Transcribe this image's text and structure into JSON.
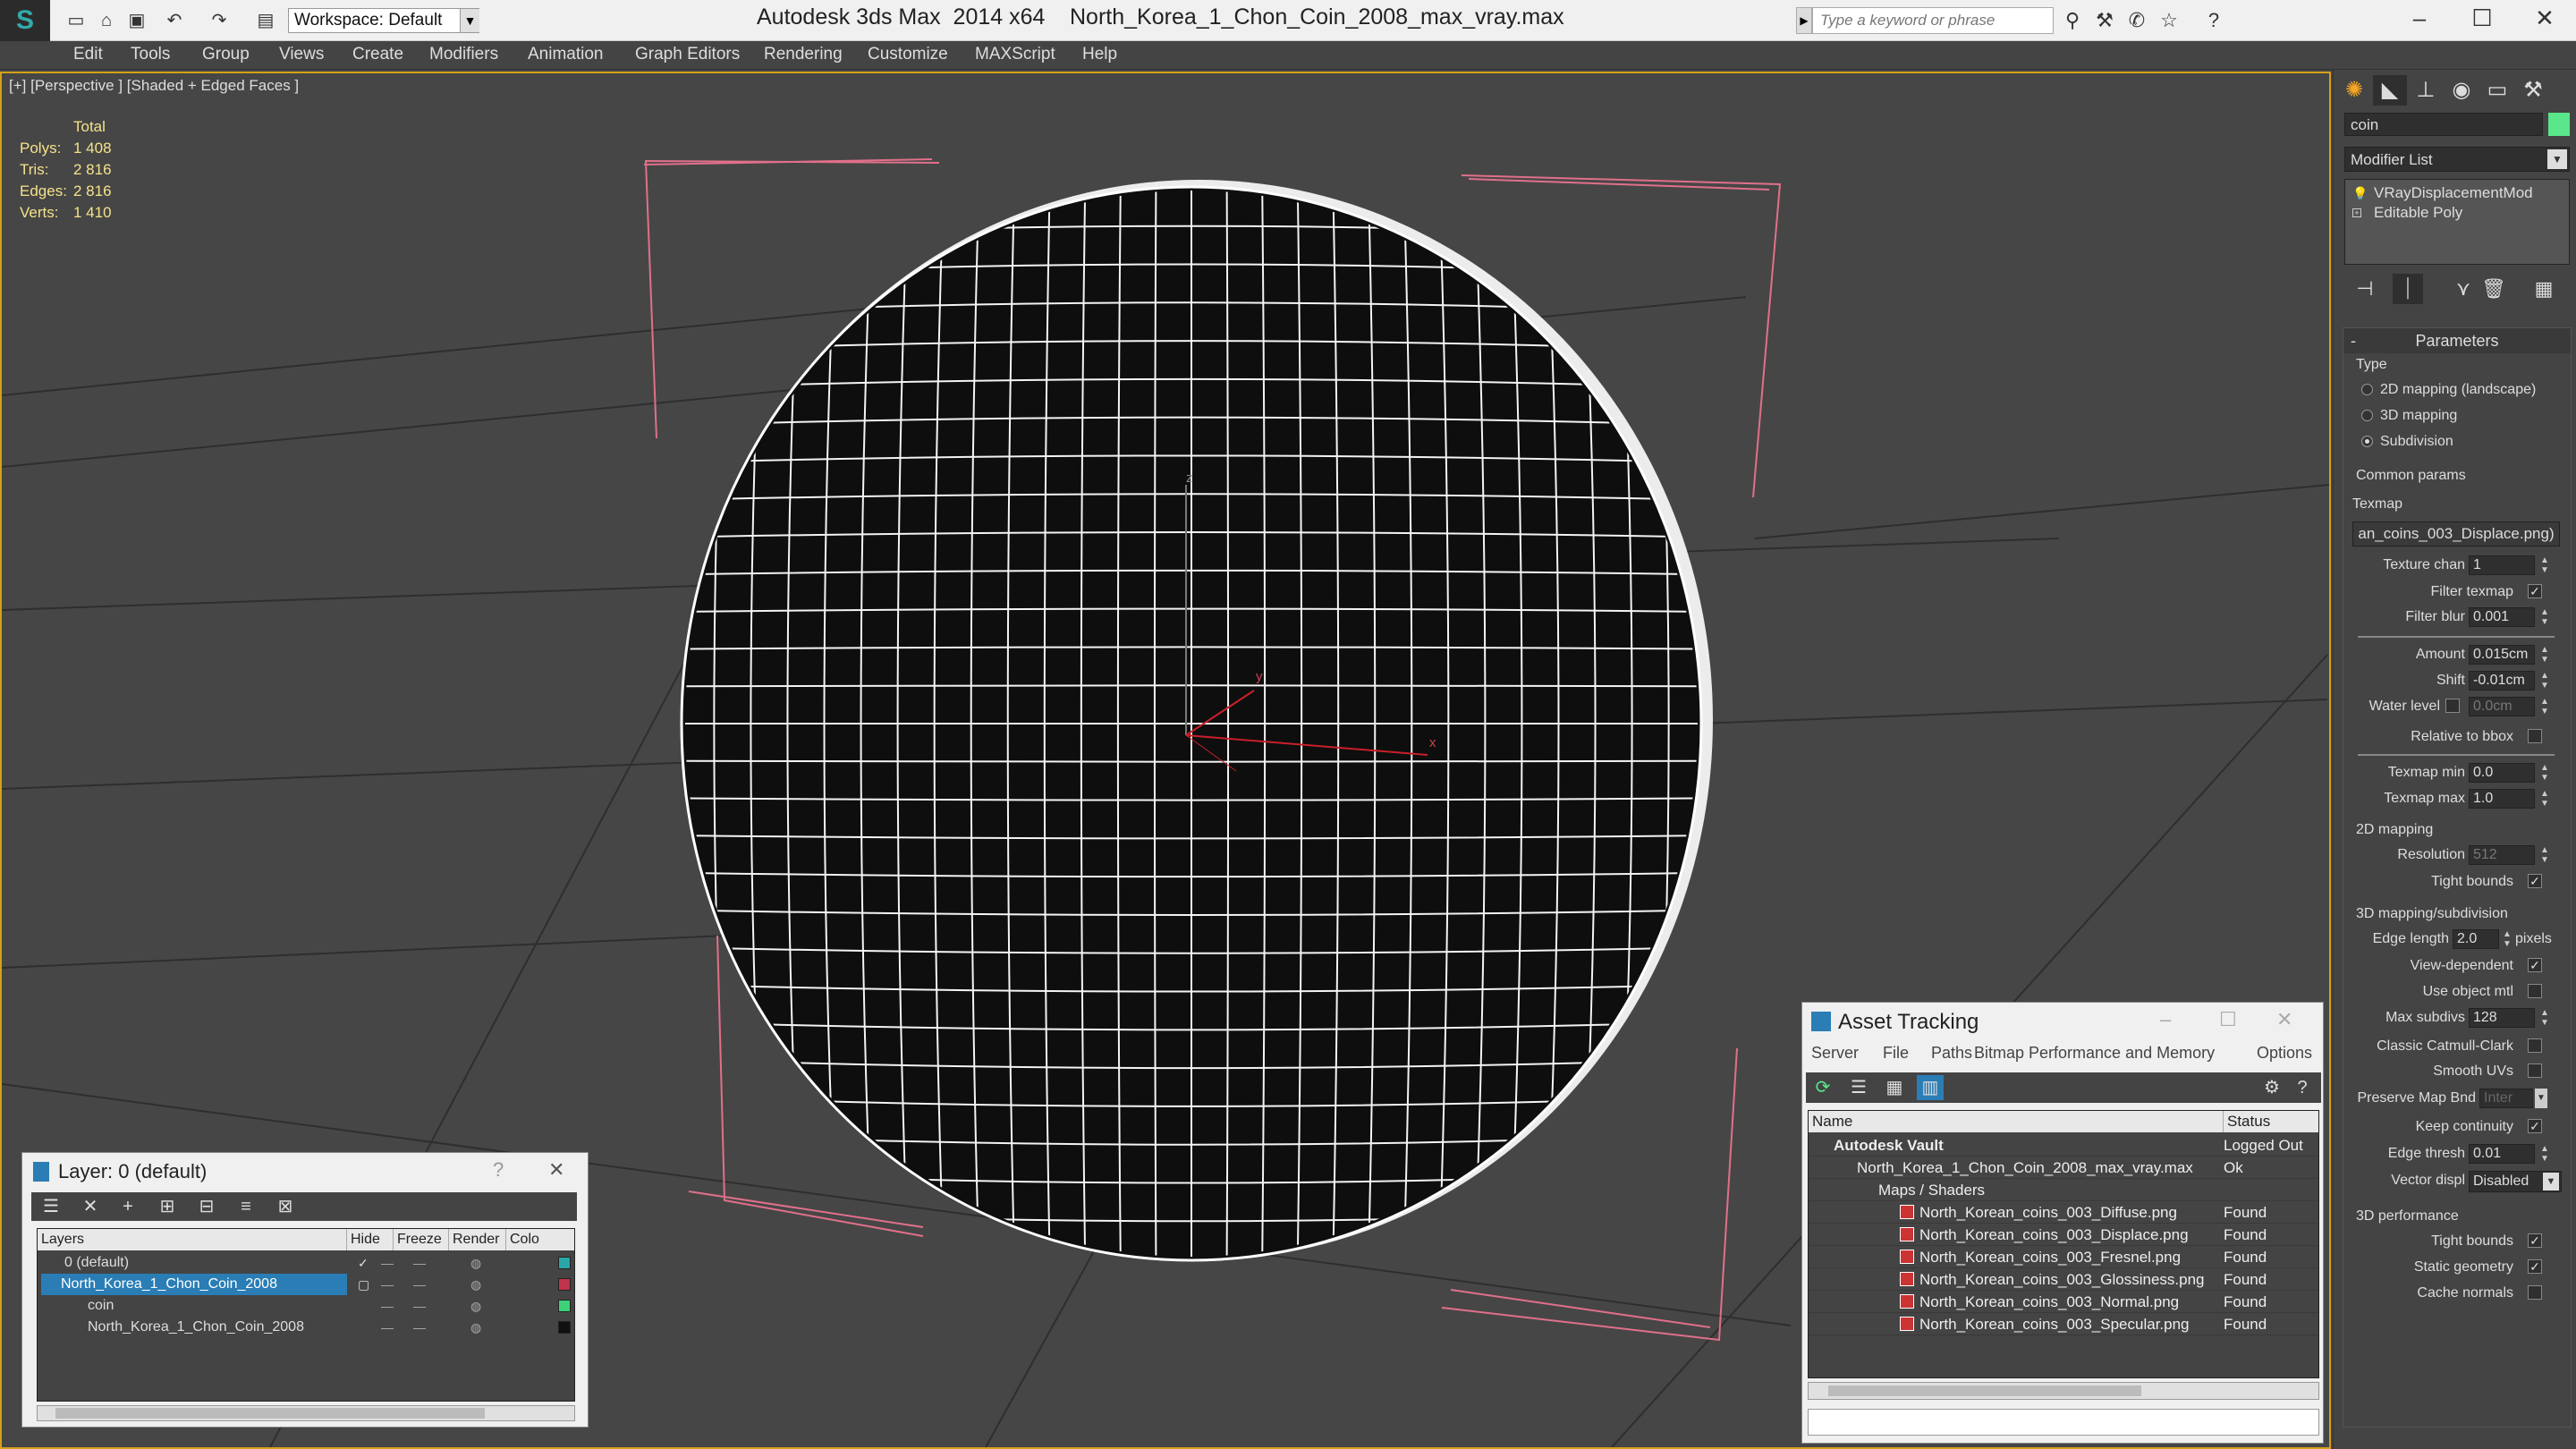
{
  "titlebar": {
    "app_title": "Autodesk 3ds Max  2014 x64",
    "file_title": "North_Korea_1_Chon_Coin_2008_max_vray.max",
    "workspace": "Workspace: Default",
    "search_placeholder": "Type a keyword or phrase"
  },
  "menu": [
    "Edit",
    "Tools",
    "Group",
    "Views",
    "Create",
    "Modifiers",
    "Animation",
    "Graph Editors",
    "Rendering",
    "Customize",
    "MAXScript",
    "Help"
  ],
  "viewport": {
    "label": "[+] [Perspective ] [Shaded + Edged Faces ]",
    "stats_header": "Total",
    "stats": [
      {
        "label": "Polys:",
        "value": "1 408"
      },
      {
        "label": "Tris:",
        "value": "2 816"
      },
      {
        "label": "Edges:",
        "value": "2 816"
      },
      {
        "label": "Verts:",
        "value": "1 410"
      }
    ],
    "axis_x": "x",
    "axis_y": "y",
    "axis_z": "z"
  },
  "command_panel": {
    "object_name": "coin",
    "modifier_list": "Modifier List",
    "stack": [
      "VRayDisplacementMod",
      "Editable Poly"
    ],
    "rollout_title": "Parameters",
    "type_group": "Type",
    "type_options": [
      "2D mapping (landscape)",
      "3D mapping",
      "Subdivision"
    ],
    "common_group": "Common params",
    "texmap_label": "Texmap",
    "texmap_value": "an_coins_003_Displace.png)",
    "texture_chan_label": "Texture chan",
    "texture_chan": "1",
    "filter_texmap": "Filter texmap",
    "filter_blur_label": "Filter blur",
    "filter_blur": "0.001",
    "amount_label": "Amount",
    "amount": "0.015cm",
    "shift_label": "Shift",
    "shift": "-0.01cm",
    "water_level_label": "Water level",
    "water_level": "0.0cm",
    "relative_bbox": "Relative to bbox",
    "texmap_min_label": "Texmap min",
    "texmap_min": "0.0",
    "texmap_max_label": "Texmap max",
    "texmap_max": "1.0",
    "mapping2d_group": "2D mapping",
    "resolution_label": "Resolution",
    "resolution": "512",
    "tight_bounds": "Tight bounds",
    "subdiv_group": "3D mapping/subdivision",
    "edge_length_label": "Edge length",
    "edge_length": "2.0",
    "pixels": "pixels",
    "view_dependent": "View-dependent",
    "use_object_mtl": "Use object mtl",
    "max_subdivs_label": "Max subdivs",
    "max_subdivs": "128",
    "classic_catmull": "Classic Catmull-Clark",
    "smooth_uvs": "Smooth UVs",
    "preserve_map_bnd_label": "Preserve Map Bnd",
    "preserve_map_bnd": "Inter",
    "keep_continuity": "Keep continuity",
    "edge_thresh_label": "Edge thresh",
    "edge_thresh": "0.01",
    "vector_displ_label": "Vector displ",
    "vector_displ": "Disabled",
    "perf_group": "3D performance",
    "tight_bounds2": "Tight bounds",
    "static_geometry": "Static geometry",
    "cache_normals": "Cache normals"
  },
  "layer_window": {
    "title": "Layer: 0 (default)",
    "columns": [
      "Layers",
      "Hide",
      "Freeze",
      "Render",
      "Colo"
    ],
    "rows": [
      {
        "name": "0 (default)",
        "color": "#2aa6a6"
      },
      {
        "name": "North_Korea_1_Chon_Coin_2008",
        "color": "#c0334a"
      },
      {
        "name": "coin",
        "color": "#3dd27a"
      },
      {
        "name": "North_Korea_1_Chon_Coin_2008",
        "color": "#111111"
      }
    ]
  },
  "asset_window": {
    "title": "Asset Tracking",
    "menu": [
      "Server",
      "File",
      "Paths",
      "Bitmap Performance and Memory",
      "Options"
    ],
    "columns": [
      "Name",
      "Status"
    ],
    "rows": [
      {
        "name": "Autodesk Vault",
        "status": "Logged Out"
      },
      {
        "name": "North_Korea_1_Chon_Coin_2008_max_vray.max",
        "status": "Ok"
      },
      {
        "name": "Maps / Shaders",
        "status": ""
      },
      {
        "name": "North_Korean_coins_003_Diffuse.png",
        "status": "Found"
      },
      {
        "name": "North_Korean_coins_003_Displace.png",
        "status": "Found"
      },
      {
        "name": "North_Korean_coins_003_Fresnel.png",
        "status": "Found"
      },
      {
        "name": "North_Korean_coins_003_Glossiness.png",
        "status": "Found"
      },
      {
        "name": "North_Korean_coins_003_Normal.png",
        "status": "Found"
      },
      {
        "name": "North_Korean_coins_003_Specular.png",
        "status": "Found"
      }
    ]
  },
  "colors": {
    "viewport_bg": "#464646",
    "stats_text": "#f5e28a",
    "selection_bracket": "#e0708a",
    "wire": "#ffffff",
    "active_border": "#d4a017",
    "object_color": "#5ae68a"
  }
}
